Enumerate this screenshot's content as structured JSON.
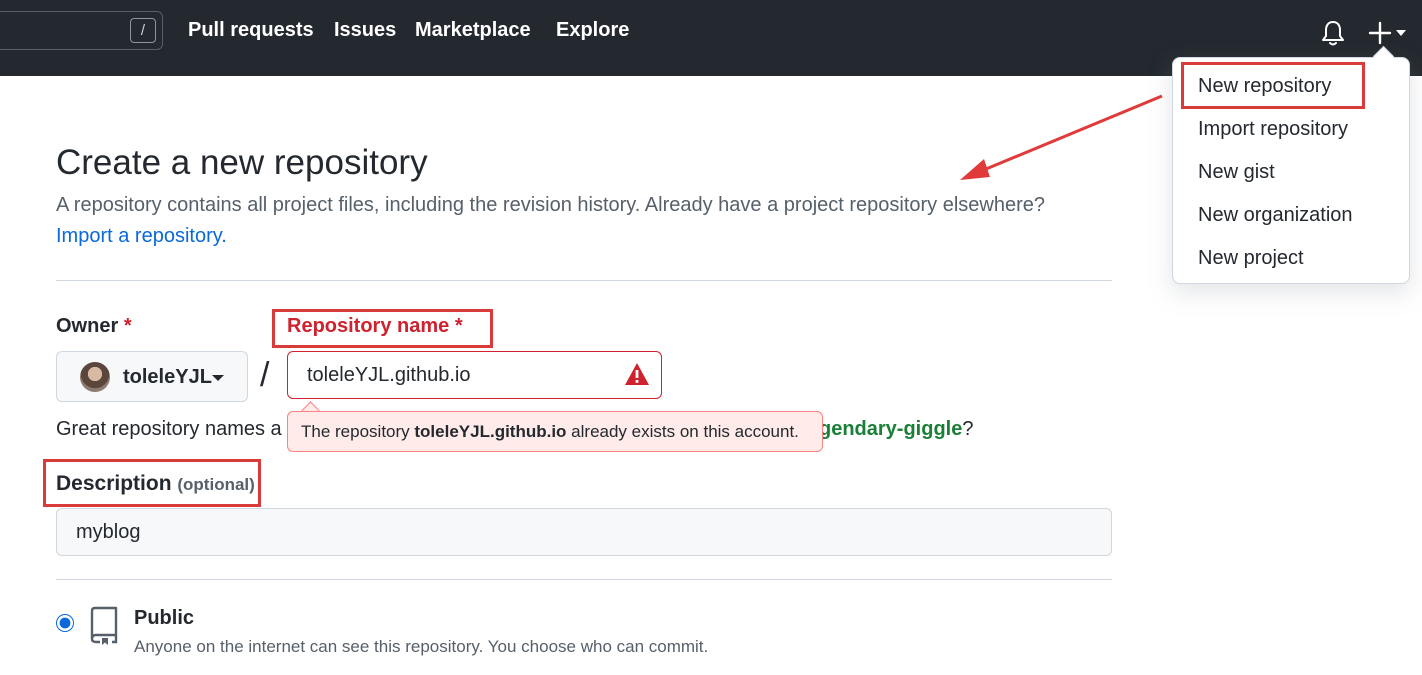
{
  "header": {
    "search_shortcut": "/",
    "nav": [
      "Pull requests",
      "Issues",
      "Marketplace",
      "Explore"
    ],
    "icons": [
      "bell-icon",
      "plus-icon",
      "caret-down-icon"
    ]
  },
  "dropdown": {
    "items": [
      "New repository",
      "Import repository",
      "New gist",
      "New organization",
      "New project"
    ]
  },
  "main": {
    "title": "Create a new repository",
    "subtitle": "A repository contains all project files, including the revision history. Already have a project repository elsewhere?",
    "import_link": "Import a repository.",
    "owner_label": "Owner",
    "required_mark": "*",
    "owner_name": "toleleYJL",
    "path_separator": "/",
    "repo_name_label": "Repository name",
    "repo_name_value": "toleleYJL.github.io",
    "hint_prefix": "Great repository names a",
    "suggestion_tail": "gendary-giggle",
    "hint_end": "?",
    "error_prefix": "The repository ",
    "error_repo": "toleleYJL.github.io",
    "error_suffix": " already exists on this account.",
    "description_label": "Description",
    "optional_label": "(optional)",
    "description_value": "myblog",
    "public_label": "Public",
    "public_desc": "Anyone on the internet can see this repository. You choose who can commit."
  },
  "colors": {
    "header_bg": "#24292f",
    "annotation_red": "#d93b3b",
    "error_red": "#cf222e",
    "link_blue": "#0969da",
    "suggestion_green": "#1a7f37"
  }
}
